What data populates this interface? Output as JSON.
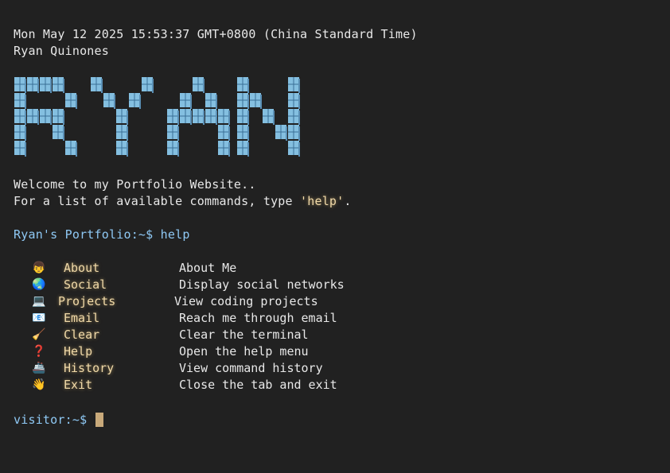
{
  "terminal": {
    "datetime": "Mon May 12 2025 15:53:37 GMT+0800 (China Standard Time)",
    "owner_name": "Ryan Quinones",
    "banner_text": "RYAN",
    "welcome_line": "Welcome to my Portfolio Website..",
    "hint_prefix": "For a list of available commands, type ",
    "hint_command": "'help'",
    "hint_suffix": ".",
    "prev_prompt": "Ryan's Portfolio:~$",
    "prev_command": "help",
    "current_prompt": "visitor:~$",
    "current_input": ""
  },
  "help_menu": [
    {
      "icon": "person-icon",
      "glyph": "👦",
      "command": "About",
      "description": "About Me"
    },
    {
      "icon": "globe-icon",
      "glyph": "🌏",
      "command": "Social",
      "description": "Display social networks"
    },
    {
      "icon": "laptop-icon",
      "glyph": "💻",
      "command": "Projects",
      "description": "View coding projects"
    },
    {
      "icon": "email-icon",
      "glyph": "📧",
      "command": "Email",
      "description": "Reach me through email"
    },
    {
      "icon": "broom-icon",
      "glyph": "🧹",
      "command": "Clear",
      "description": "Clear the terminal"
    },
    {
      "icon": "question-icon",
      "glyph": "❓",
      "command": "Help",
      "description": "Open the help menu"
    },
    {
      "icon": "ship-icon",
      "glyph": "🚢",
      "command": "History",
      "description": "View command history"
    },
    {
      "icon": "wave-icon",
      "glyph": "👋",
      "command": "Exit",
      "description": "Close the tab and exit"
    }
  ],
  "colors": {
    "background": "#212121",
    "text": "#e8e8e8",
    "highlight": "#f0d9a8",
    "prompt": "#8fc9f5",
    "banner": "#8fd0f5",
    "cursor": "#c8a97a"
  }
}
